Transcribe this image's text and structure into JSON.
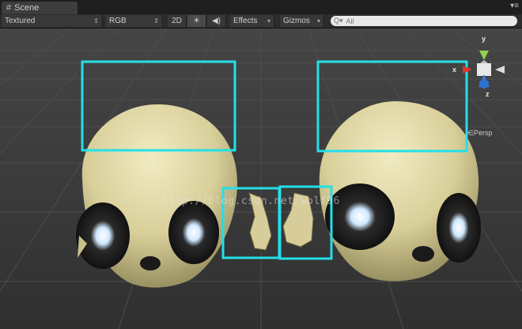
{
  "window": {
    "tab_title": "Scene",
    "tab_icon": "grid-icon"
  },
  "toolbar": {
    "render_mode": "Textured",
    "color_channel": "RGB",
    "mode_2d": "2D",
    "lighting_icon": "sun-icon",
    "audio_icon": "speaker-icon",
    "effects_label": "Effects",
    "gizmos_label": "Gizmos",
    "search_placeholder": "All"
  },
  "orientation_gizmo": {
    "x_label": "x",
    "y_label": "y",
    "z_label": "z",
    "projection_label": "Persp"
  },
  "viewport": {
    "watermark": "http://blog.csdn.net/wolf96",
    "selection_color": "#22e0e8"
  }
}
